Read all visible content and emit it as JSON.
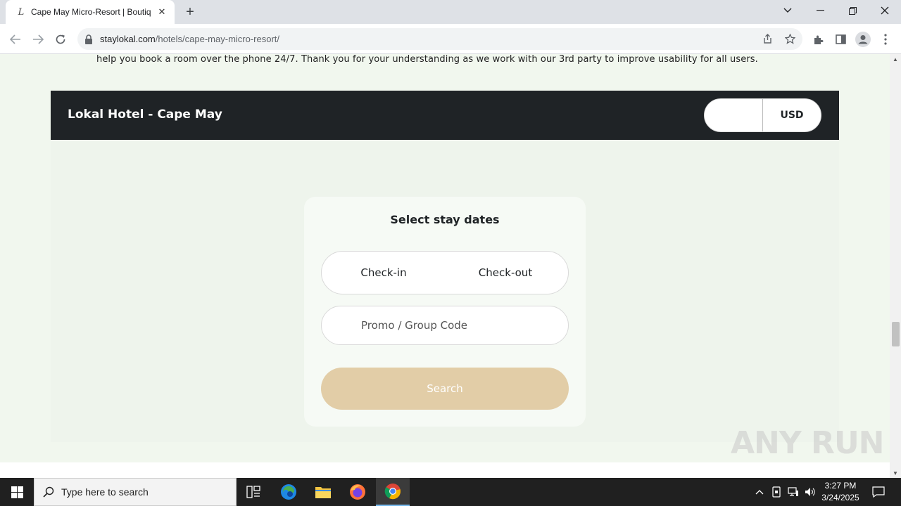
{
  "browser": {
    "tab_title": "Cape May Micro-Resort | Boutiq",
    "tab_favicon": "L",
    "url_host": "staylokal.com",
    "url_path": "/hotels/cape-may-micro-resort/"
  },
  "page": {
    "notice": "help you book a room over the phone 24/7. Thank you for your understanding as we work with our 3rd party to improve usability for all users.",
    "hotel_name": "Lokal Hotel - Cape May",
    "currency": "USD",
    "booking": {
      "title": "Select stay dates",
      "checkin": "Check-in",
      "checkout": "Check-out",
      "promo_placeholder": "Promo / Group Code",
      "search_label": "Search"
    },
    "watermark": "ANY RUN"
  },
  "taskbar": {
    "search_placeholder": "Type here to search",
    "time": "3:27 PM",
    "date": "3/24/2025"
  },
  "colors": {
    "header_bg": "#1f2326",
    "search_button": "#e2cda7",
    "page_bg": "#f1f7ee"
  }
}
